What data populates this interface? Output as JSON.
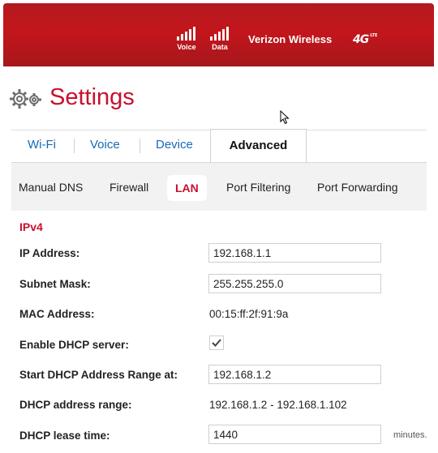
{
  "status": {
    "voice_label": "Voice",
    "data_label": "Data",
    "carrier": "Verizon Wireless",
    "network_badge": "4G",
    "network_badge_sub": "LTE"
  },
  "page": {
    "title": "Settings"
  },
  "tabs": [
    "Wi-Fi",
    "Voice",
    "Device",
    "Advanced"
  ],
  "active_tab": "Advanced",
  "subtabs": [
    "Manual DNS",
    "Firewall",
    "LAN",
    "Port Filtering",
    "Port Forwarding"
  ],
  "active_subtab": "LAN",
  "ipv4": {
    "section_title": "IPv4",
    "ip_address": {
      "label": "IP Address:",
      "value": "192.168.1.1"
    },
    "subnet_mask": {
      "label": "Subnet Mask:",
      "value": "255.255.255.0"
    },
    "mac_address": {
      "label": "MAC Address:",
      "value": "00:15:ff:2f:91:9a"
    },
    "enable_dhcp": {
      "label": "Enable DHCP server:",
      "checked": true
    },
    "dhcp_start": {
      "label": "Start DHCP Address Range at:",
      "value": "192.168.1.2"
    },
    "dhcp_range": {
      "label": "DHCP address range:",
      "value": "192.168.1.2 - 192.168.1.102"
    },
    "lease_time": {
      "label": "DHCP lease time:",
      "value": "1440",
      "unit": "minutes."
    }
  },
  "icons": {
    "settings": "gear-icon",
    "cursor": "mouse-pointer-icon",
    "voice_signal": "signal-bars-icon",
    "data_signal": "signal-bars-icon",
    "check": "checkmark-icon"
  },
  "colors": {
    "brand_red": "#c3161c",
    "title_red": "#c8102e",
    "link_blue": "#1769b8"
  }
}
